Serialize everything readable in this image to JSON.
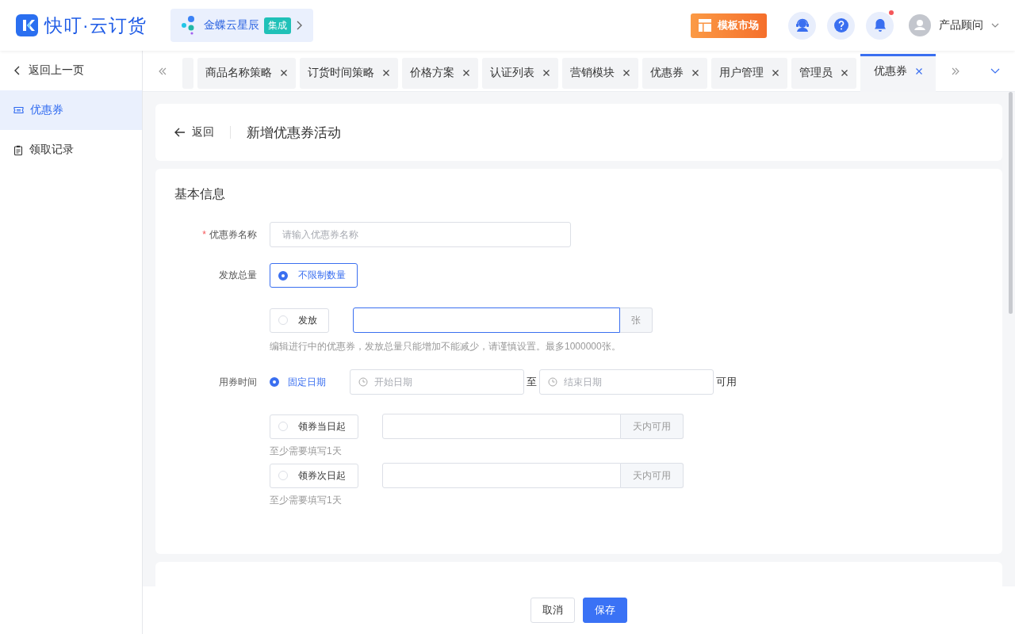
{
  "brand": {
    "name": "快叮·云订货"
  },
  "integration": {
    "name": "金蝶云星辰",
    "badge": "集成"
  },
  "template_market": {
    "label": "模板市场"
  },
  "notifications": {
    "unread": true
  },
  "user": {
    "name": "产品顾问"
  },
  "sidebar": {
    "back": "返回上一页",
    "items": [
      {
        "label": "优惠券",
        "selected": true,
        "kind": "coupon"
      },
      {
        "label": "领取记录",
        "selected": false,
        "kind": "records"
      }
    ]
  },
  "tabs": [
    {
      "label": "商品名称策略",
      "selected": false
    },
    {
      "label": "订货时间策略",
      "selected": false
    },
    {
      "label": "价格方案",
      "selected": false
    },
    {
      "label": "认证列表",
      "selected": false
    },
    {
      "label": "营销模块",
      "selected": false
    },
    {
      "label": "优惠券",
      "selected": false
    },
    {
      "label": "用户管理",
      "selected": false
    },
    {
      "label": "管理员",
      "selected": false
    },
    {
      "label": "优惠券",
      "selected": true
    }
  ],
  "page_header": {
    "back": "返回",
    "title": "新增优惠券活动"
  },
  "basic_info": {
    "title": "基本信息",
    "name_field": {
      "label": "优惠券名称",
      "required_mark": "*",
      "placeholder": "请输入优惠券名称"
    },
    "quantity": {
      "label": "发放总量",
      "options": [
        {
          "kind": "plain",
          "label": "不限制数量",
          "selected": true
        },
        {
          "kind": "amount",
          "label": "发放",
          "selected": false,
          "focused": true,
          "unit": "张"
        }
      ],
      "hint": "编辑进行中的优惠券，发放总量只能增加不能减少，请谨慎设置。最多1000000张。"
    },
    "usage_time": {
      "label": "用券时间",
      "options": [
        {
          "kind": "range",
          "label": "固定日期",
          "selected": true,
          "start_placeholder": "开始日期",
          "separator": "至",
          "end_placeholder": "结束日期",
          "suffix": "可用"
        },
        {
          "kind": "days",
          "label": "领券当日起",
          "selected": false,
          "unit": "天内可用",
          "hint": "至少需要填写1天"
        },
        {
          "kind": "days",
          "label": "领券次日起",
          "selected": false,
          "unit": "天内可用",
          "hint": "至少需要填写1天"
        }
      ]
    }
  },
  "footer": {
    "buttons": [
      {
        "label": "取消",
        "kind": "default"
      },
      {
        "label": "保存",
        "kind": "primary"
      }
    ]
  }
}
